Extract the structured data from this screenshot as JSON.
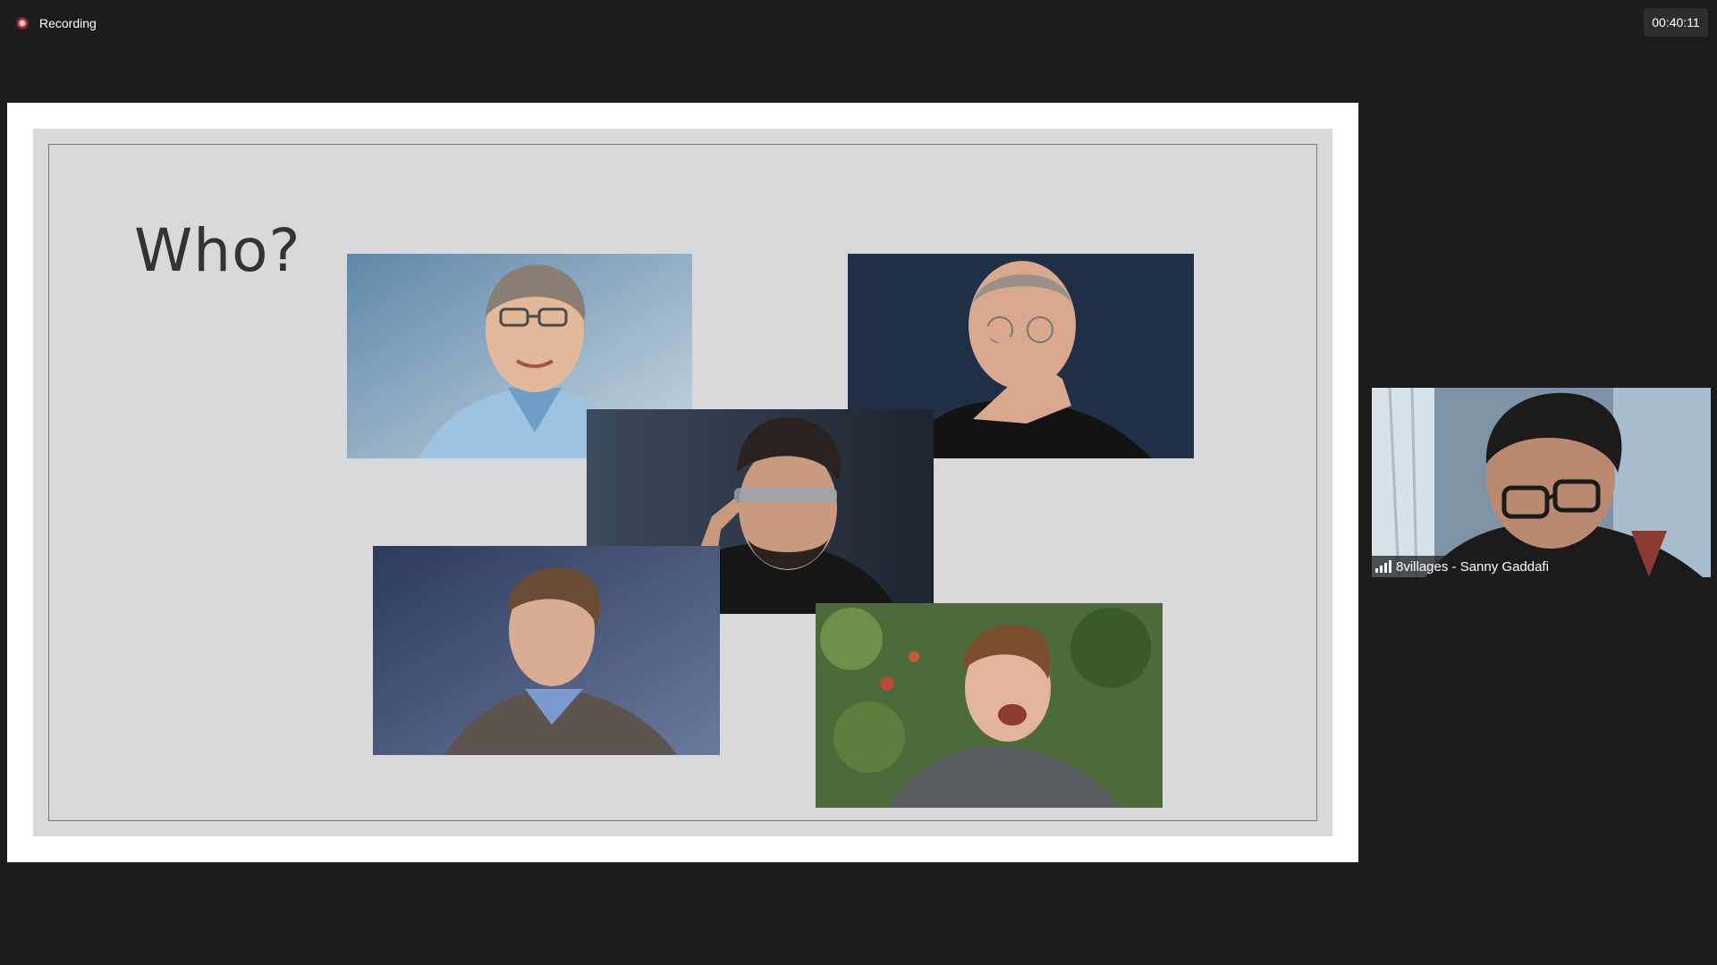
{
  "recording": {
    "label": "Recording",
    "icon": "record-icon"
  },
  "timer": {
    "value": "00:40:11"
  },
  "slide": {
    "title": "Who?"
  },
  "participant": {
    "name": "8villages - Sanny Gaddafi",
    "icon": "signal-strength-icon"
  },
  "colors": {
    "background": "#1c1c1c",
    "slide_background": "#d9d8da",
    "recording_red": "#e04a4a"
  }
}
